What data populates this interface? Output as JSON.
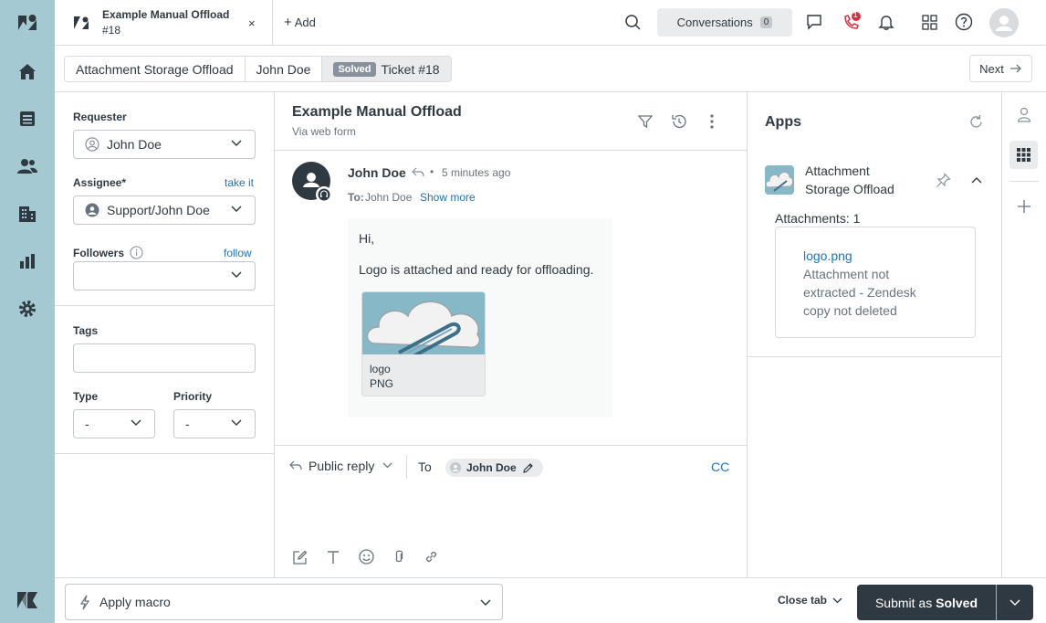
{
  "tab": {
    "title": "Example Manual Offload",
    "number": "#18",
    "close": "×"
  },
  "topbar": {
    "add_label": "Add",
    "conversations_label": "Conversations",
    "conversations_count": "0",
    "call_badge": "1"
  },
  "breadcrumb": {
    "items": [
      "Attachment Storage Offload",
      "John Doe"
    ],
    "status_badge": "Solved",
    "ticket": "Ticket #18"
  },
  "next_label": "Next",
  "props": {
    "requester_label": "Requester",
    "requester_value": "John Doe",
    "assignee_label": "Assignee*",
    "take_it": "take it",
    "assignee_value": "Support/John Doe",
    "followers_label": "Followers",
    "follow": "follow",
    "tags_label": "Tags",
    "type_label": "Type",
    "type_value": "-",
    "priority_label": "Priority",
    "priority_value": "-"
  },
  "conversation": {
    "subject": "Example Manual Offload",
    "via": "Via web form",
    "author": "John Doe",
    "time": "5 minutes ago",
    "to_label": "To:",
    "to_value": "John Doe",
    "show_more": "Show more",
    "greeting": "Hi,",
    "body": "Logo is attached and ready for offloading.",
    "attachment_name": "logo",
    "attachment_type": "PNG"
  },
  "reply": {
    "mode": "Public reply",
    "to_label": "To",
    "recipient": "John Doe",
    "cc": "CC"
  },
  "apps": {
    "title": "Apps",
    "app_name_line1": "Attachment",
    "app_name_line2": "Storage Offload",
    "attachments_count": "Attachments: 1",
    "file_link": "logo.png",
    "status_line1": "Attachment not",
    "status_line2": "extracted - Zendesk",
    "status_line3": "copy not deleted"
  },
  "footer": {
    "macro_label": "Apply macro",
    "close_tab": "Close tab",
    "submit_prefix": "Submit as ",
    "submit_status": "Solved"
  },
  "colors": {
    "nav_bg": "#a4c9d3",
    "link": "#1f73b7",
    "dark": "#2f3941",
    "alert": "#cc3340"
  }
}
